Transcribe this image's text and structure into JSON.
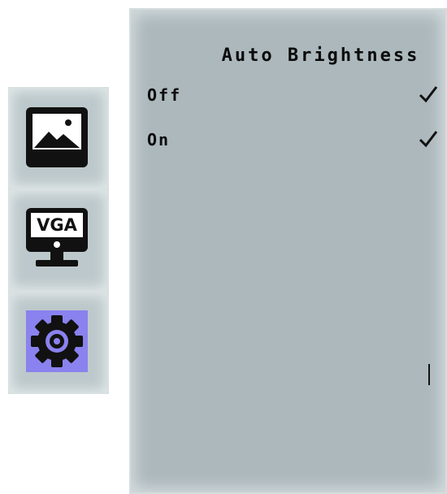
{
  "sidebar": {
    "items": [
      {
        "icon": "picture-icon",
        "selected": false
      },
      {
        "icon": "vga-monitor-icon",
        "label": "VGA",
        "selected": false
      },
      {
        "icon": "gear-icon",
        "selected": true
      }
    ],
    "selected_color": "#8a82ee"
  },
  "panel": {
    "title": "Auto Brightness",
    "options": [
      {
        "label": "Off",
        "checked": true
      },
      {
        "label": "On",
        "checked": true
      }
    ]
  }
}
